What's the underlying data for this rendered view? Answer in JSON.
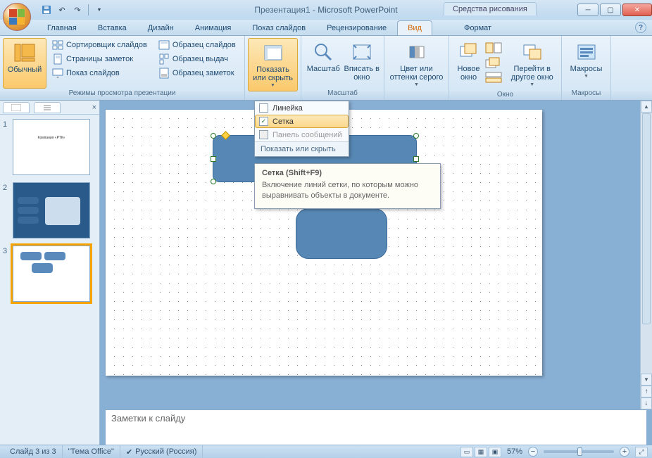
{
  "title": {
    "doc": "Презентация1",
    "app": "Microsoft PowerPoint"
  },
  "contextual_tool_label": "Средства рисования",
  "tabs": [
    "Главная",
    "Вставка",
    "Дизайн",
    "Анимация",
    "Показ слайдов",
    "Рецензирование",
    "Вид",
    "Формат"
  ],
  "active_tab": "Вид",
  "ribbon": {
    "group1": {
      "label": "Режимы просмотра презентации",
      "normal": "Обычный",
      "items": [
        "Сортировщик слайдов",
        "Страницы заметок",
        "Показ слайдов",
        "Образец слайдов",
        "Образец выдач",
        "Образец заметок"
      ]
    },
    "group2": {
      "label": "",
      "show_hide": "Показать или скрыть"
    },
    "group3": {
      "label": "Масштаб",
      "zoom": "Масштаб",
      "fit": "Вписать в окно"
    },
    "group4": {
      "label": "",
      "color": "Цвет или оттенки серого"
    },
    "group5": {
      "label": "Окно",
      "new_win": "Новое окно",
      "switch": "Перейти в другое окно"
    },
    "group6": {
      "label": "Макросы",
      "macros": "Макросы"
    }
  },
  "dropdown": {
    "ruler": "Линейка",
    "grid": "Сетка",
    "msgpane": "Панель сообщений",
    "footer": "Показать или скрыть"
  },
  "tooltip": {
    "title": "Сетка (Shift+F9)",
    "body": "Включение линий сетки, по которым можно выравнивать объекты в документе."
  },
  "notes_placeholder": "Заметки к слайду",
  "statusbar": {
    "slide": "Слайд 3 из 3",
    "theme": "\"Тема Office\"",
    "lang": "Русский (Россия)",
    "zoom": "57%"
  }
}
